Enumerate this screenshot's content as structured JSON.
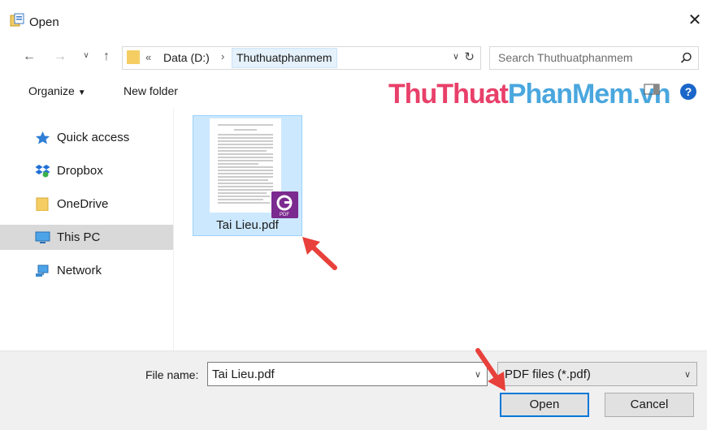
{
  "window": {
    "title": "Open"
  },
  "nav": {
    "path_sep": "«",
    "drive": "Data (D:)",
    "crumb_sep": "›",
    "current_folder": "Thuthuatphanmem",
    "search_placeholder": "Search Thuthuatphanmem"
  },
  "toolbar": {
    "organize_label": "Organize",
    "new_folder_label": "New folder",
    "help_label": "?"
  },
  "watermark": {
    "part1": "ThuThuat",
    "part2": "PhanMem",
    "part3": ".vn"
  },
  "sidebar": {
    "items": [
      {
        "label": "Quick access",
        "icon": "star-icon"
      },
      {
        "label": "Dropbox",
        "icon": "dropbox-icon"
      },
      {
        "label": "OneDrive",
        "icon": "folder-icon"
      },
      {
        "label": "This PC",
        "icon": "computer-icon",
        "selected": true
      },
      {
        "label": "Network",
        "icon": "network-icon"
      }
    ]
  },
  "files": [
    {
      "name": "Tai Lieu.pdf",
      "type_badge": "PDF"
    }
  ],
  "bottom": {
    "file_name_label": "File name:",
    "file_name_value": "Tai Lieu.pdf",
    "file_type_value": "PDF files (*.pdf)",
    "open_label": "Open",
    "cancel_label": "Cancel"
  },
  "colors": {
    "selection_bg": "#cce8ff",
    "accent": "#0078d7",
    "arrow": "#e8403a",
    "watermark_pink": "#e8406a",
    "watermark_blue": "#4aa7de"
  }
}
